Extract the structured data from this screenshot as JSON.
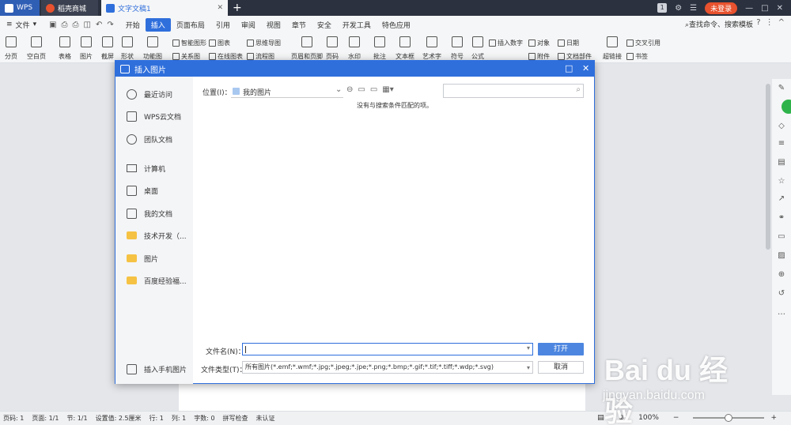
{
  "titlebar": {
    "tabs": [
      {
        "label": "WPS"
      },
      {
        "label": "稻壳商城"
      },
      {
        "label": "文字文稿1"
      }
    ],
    "badge_count": "1",
    "login_label": "未登录"
  },
  "menubar": {
    "file_label": "文件",
    "items": [
      "开始",
      "插入",
      "页面布局",
      "引用",
      "审阅",
      "视图",
      "章节",
      "安全",
      "开发工具",
      "特色应用"
    ],
    "active_index": 1,
    "search_label": "查找命令、搜索模板"
  },
  "ribbon": {
    "big": [
      "分页",
      "空白页",
      "表格",
      "图片",
      "截屏",
      "形状",
      "功能图",
      "页眉和页脚",
      "页码",
      "水印",
      "批注",
      "文本框",
      "艺术字",
      "符号",
      "公式",
      "超链接"
    ],
    "small": [
      "智能图形",
      "图表",
      "思维导图",
      "关系图",
      "在线图表",
      "流程图",
      "插入数字",
      "对象",
      "日期",
      "附件",
      "文档部件",
      "交叉引用",
      "书签"
    ]
  },
  "dialog": {
    "title": "插入图片",
    "sidebar": [
      {
        "label": "最近访问",
        "icon": "clock-icon"
      },
      {
        "label": "WPS云文档",
        "icon": "cloud-box-icon"
      },
      {
        "label": "团队文档",
        "icon": "team-icon"
      },
      {
        "label": "计算机",
        "icon": "monitor-icon"
      },
      {
        "label": "桌面",
        "icon": "desktop-icon"
      },
      {
        "label": "我的文档",
        "icon": "documents-icon"
      },
      {
        "label": "技术开发（...",
        "icon": "folder-icon"
      },
      {
        "label": "图片",
        "icon": "folder-icon"
      },
      {
        "label": "百度经验福...",
        "icon": "folder-icon"
      }
    ],
    "phone_images_label": "插入手机图片",
    "location_label": "位置(I)：",
    "location_value": "我的图片",
    "empty_message": "没有与搜索条件匹配的项。",
    "filename_label": "文件名(N)：",
    "filename_value": "",
    "filetype_label": "文件类型(T)：",
    "filetype_value": "所有图片(*.emf;*.wmf;*.jpg;*.jpeg;*.jpe;*.png;*.bmp;*.gif;*.tif;*.tiff;*.wdp;*.svg)",
    "open_label": "打开",
    "cancel_label": "取消"
  },
  "statusbar": {
    "items": [
      "页码: 1",
      "页面: 1/1",
      "节: 1/1",
      "设置值: 2.5厘米",
      "行: 1",
      "列: 1",
      "字数: 0",
      "拼写检查",
      "未认证"
    ],
    "zoom": "100%"
  },
  "watermark": {
    "big": "Bai du 经验",
    "small": "jingyan.baidu.com"
  }
}
